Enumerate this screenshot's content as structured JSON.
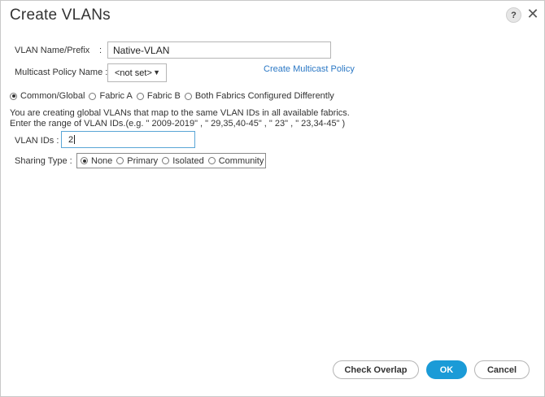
{
  "dialog": {
    "title": "Create VLANs",
    "help_label": "?",
    "close_label": "✕"
  },
  "form": {
    "vlan_name_label": "VLAN Name/Prefix",
    "vlan_name_colon": ":",
    "vlan_name_value": "Native-VLAN",
    "multicast_label": "Multicast Policy Name :",
    "multicast_value": "<not set>",
    "multicast_caret": "▼",
    "create_multicast_link": "Create Multicast Policy",
    "fabric_options": [
      {
        "label": "Common/Global",
        "checked": true
      },
      {
        "label": "Fabric A",
        "checked": false
      },
      {
        "label": "Fabric B",
        "checked": false
      },
      {
        "label": "Both Fabrics Configured Differently",
        "checked": false
      }
    ],
    "info_line1": "You are creating global VLANs that map to the same VLAN IDs in all available fabrics.",
    "info_line2": "Enter the range of VLAN IDs.(e.g. \" 2009-2019\" , \" 29,35,40-45\" , \" 23\" , \" 23,34-45\" )",
    "vlan_ids_label": "VLAN IDs :",
    "vlan_ids_value": "2",
    "sharing_label": "Sharing Type :",
    "sharing_options": [
      {
        "label": "None",
        "checked": true
      },
      {
        "label": "Primary",
        "checked": false
      },
      {
        "label": "Isolated",
        "checked": false
      },
      {
        "label": "Community",
        "checked": false
      }
    ]
  },
  "footer": {
    "check_overlap_label": "Check Overlap",
    "ok_label": "OK",
    "cancel_label": "Cancel"
  },
  "colors": {
    "link": "#2b78c5",
    "primary_button": "#1b9bd7",
    "focus_border": "#5aa6d6"
  }
}
